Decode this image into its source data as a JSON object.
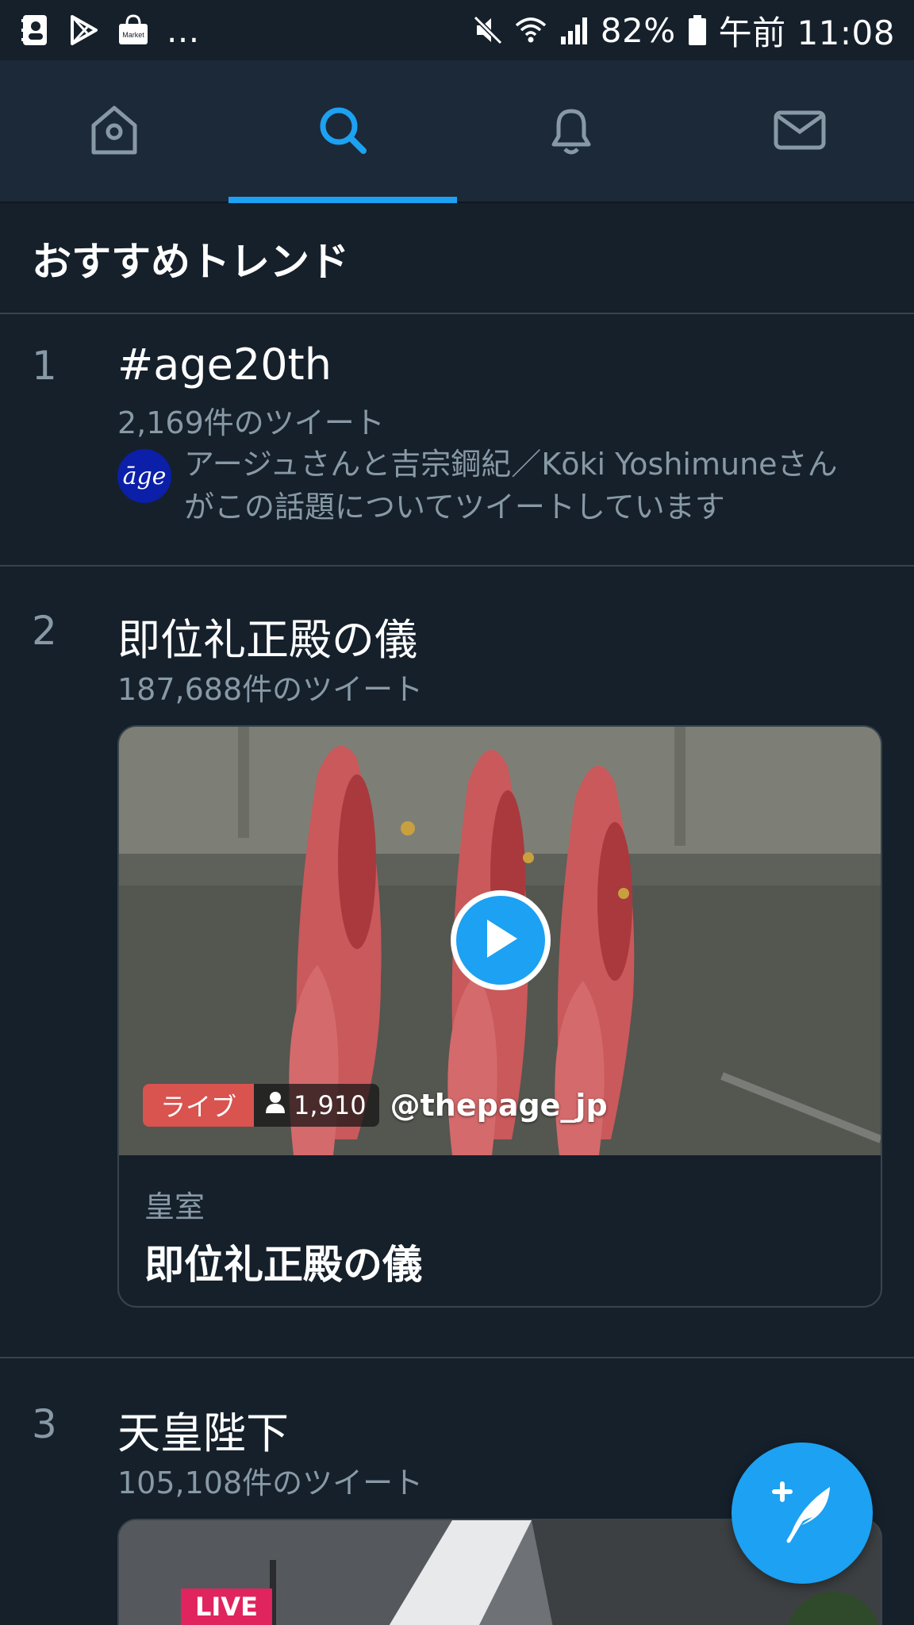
{
  "status_bar": {
    "battery_percent": "82%",
    "time": "午前 11:08",
    "overflow": "...",
    "market_label": "Market"
  },
  "nav": {
    "tabs": [
      {
        "icon": "home-icon",
        "active": false
      },
      {
        "icon": "search-icon",
        "active": true
      },
      {
        "icon": "bell-icon",
        "active": false
      },
      {
        "icon": "mail-icon",
        "active": false
      }
    ]
  },
  "header": {
    "title": "おすすめトレンド"
  },
  "trends": [
    {
      "rank": "1",
      "title": "#age20th",
      "count": "2,169件のツイート",
      "avatar_text": "āge",
      "social_context": "アージュさんと吉宗鋼紀／Kōki Yoshimuneさんがこの話題についてツイートしています"
    },
    {
      "rank": "2",
      "title": "即位礼正殿の儀",
      "count": "187,688件のツイート",
      "card": {
        "live_label": "ライブ",
        "viewers": "1,910",
        "broadcaster": "@thepage_jp",
        "category": "皇室",
        "title": "即位礼正殿の儀"
      }
    },
    {
      "rank": "3",
      "title": "天皇陛下",
      "count": "105,108件のツイート",
      "card": {
        "live_label": "LIVE"
      }
    }
  ],
  "colors": {
    "background": "#15202b",
    "nav_background": "#1c2938",
    "accent": "#1da1f2",
    "secondary_text": "#8899a6",
    "divider": "#38444d",
    "live_red": "#d9534f"
  }
}
